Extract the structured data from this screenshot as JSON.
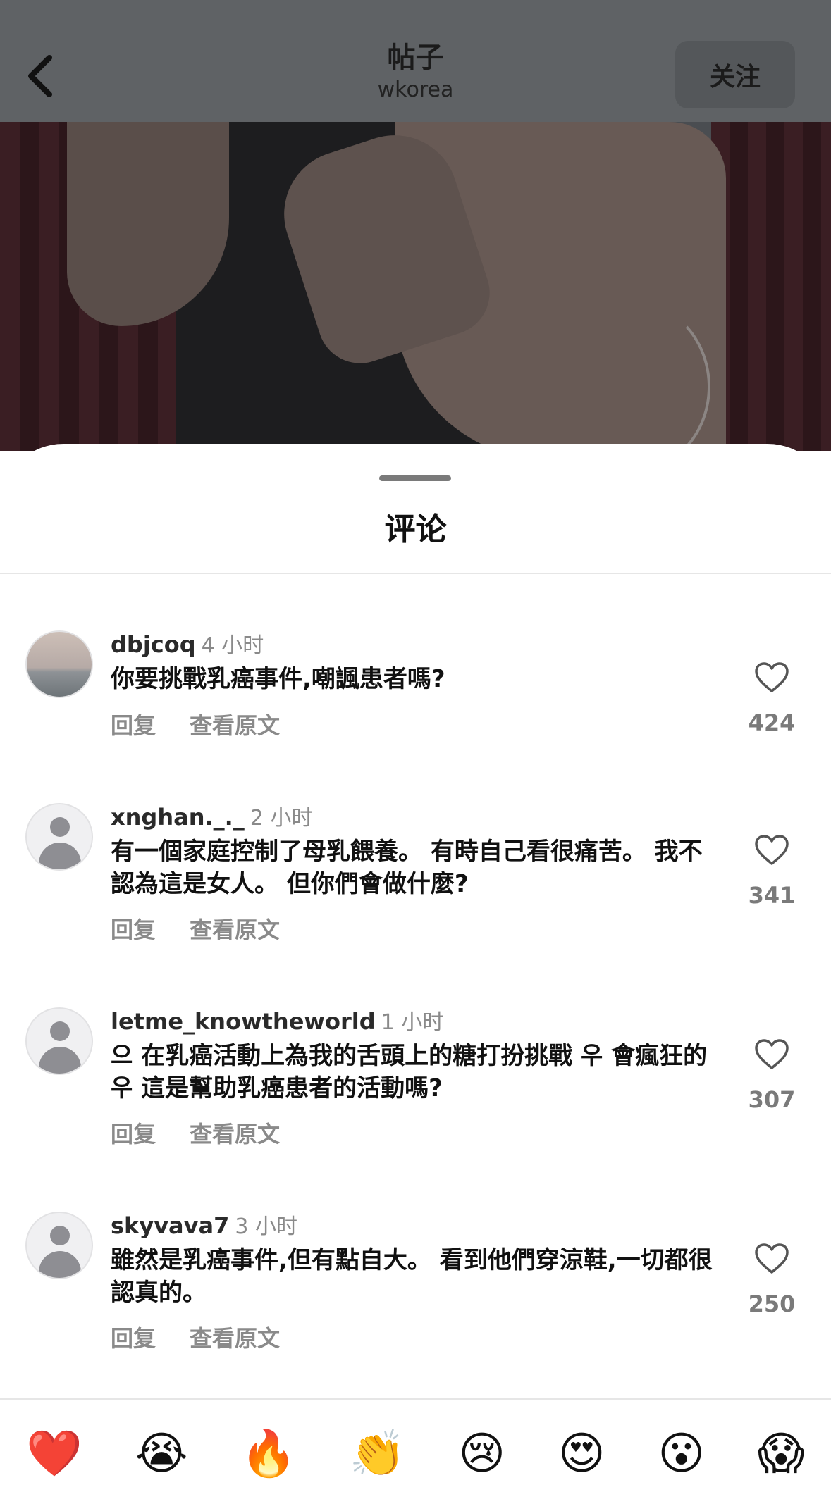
{
  "header": {
    "title": "帖子",
    "subtitle": "wkorea",
    "follow_label": "关注"
  },
  "sheet": {
    "title": "评论"
  },
  "comments": [
    {
      "username": "dbjcoq",
      "time": "4 小时",
      "text": "你要挑戰乳癌事件,嘲諷患者嗎?",
      "reply_label": "回复",
      "translate_label": "查看原文",
      "likes": "424"
    },
    {
      "username": "xnghan._._",
      "time": "2 小时",
      "text": "有一個家庭控制了母乳餵養。 有時自己看很痛苦。 我不認為這是女人。 但你們會做什麼?",
      "reply_label": "回复",
      "translate_label": "查看原文",
      "likes": "341"
    },
    {
      "username": "letme_knowtheworld",
      "time": "1 小时",
      "text": "으 在乳癌活動上為我的舌頭上的糖打扮挑戰 우 會瘋狂的 우 這是幫助乳癌患者的活動嗎?",
      "reply_label": "回复",
      "translate_label": "查看原文",
      "likes": "307"
    },
    {
      "username": "skyvava7",
      "time": "3 小时",
      "text": "雖然是乳癌事件,但有點自大。 看到他們穿涼鞋,一切都很認真的。",
      "reply_label": "回复",
      "translate_label": "查看原文",
      "likes": "250"
    }
  ],
  "emoji_bar": [
    "❤️",
    "😭",
    "🔥",
    "👏",
    "😢",
    "😍",
    "😮",
    "😱"
  ]
}
